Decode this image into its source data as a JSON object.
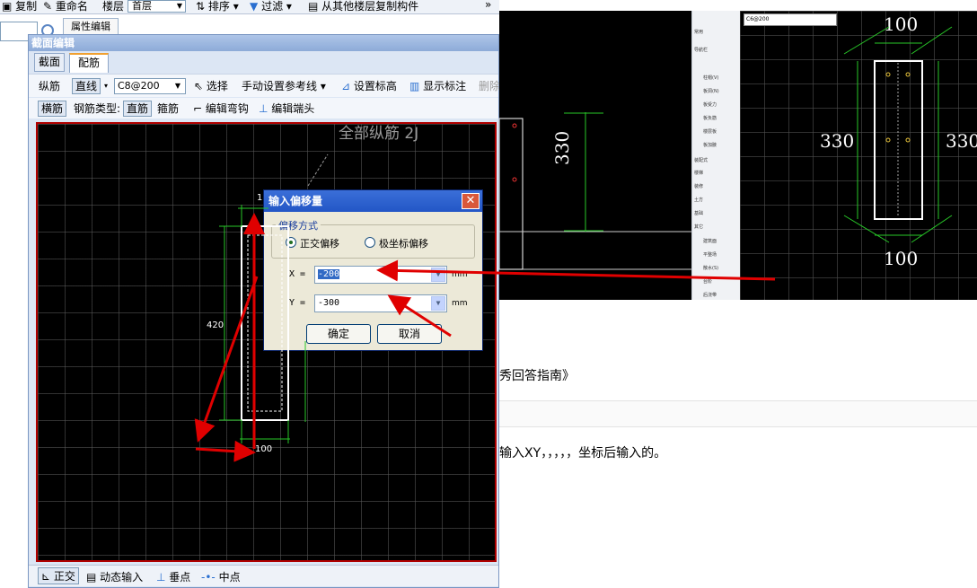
{
  "top_toolbar": {
    "copy": "复制",
    "rename": "重命名",
    "floor_label": "楼层",
    "floor_value": "首层",
    "sort": "排序",
    "filter": "过滤",
    "copy_from_floor": "从其他楼层复制构件",
    "more": "»"
  },
  "prop_tab": "属性编辑",
  "editor": {
    "title": "截面编辑",
    "tabs": [
      "截面",
      "配筋"
    ],
    "row1": {
      "longitudinal": "纵筋",
      "line": "直线",
      "spec_value": "C8@200",
      "select": "选择",
      "manual_ref": "手动设置参考线",
      "set_elevation": "设置标高",
      "show_labels": "显示标注",
      "delete": "删除"
    },
    "row2": {
      "transverse": "横筋",
      "rebar_type_label": "钢筋类型:",
      "straight": "直筋",
      "stirrup": "箍筋",
      "edit_hook": "编辑弯钩",
      "edit_end": "编辑端头"
    },
    "canvas": {
      "annotation": "全部纵筋 2J",
      "dim_top": "10",
      "dim_left": "420",
      "dim_bottom": "100"
    },
    "status": {
      "ortho": "正交",
      "dynamic_input": "动态输入",
      "perpendicular": "垂点",
      "midpoint": "中点"
    }
  },
  "dialog": {
    "title": "输入偏移量",
    "group_label": "偏移方式",
    "opt_ortho": "正交偏移",
    "opt_polar": "极坐标偏移",
    "x_label": "X =",
    "x_value": "-200",
    "y_label": "Y =",
    "y_value": "-300",
    "unit": "mm",
    "ok": "确定",
    "cancel": "取消"
  },
  "right_panel1": {
    "dim": "330"
  },
  "right_panel2": {
    "combo": "C6@200",
    "dim_top": "100",
    "dim_left": "330",
    "dim_right": "330",
    "dim_bottom": "100"
  },
  "sidebar": {
    "items": [
      "常用",
      "导航栏",
      "柱帽(V)",
      "板洞(N)",
      "板受力",
      "板负筋",
      "楼层板",
      "板加腋",
      "装配式",
      "楼梯",
      "装修",
      "土方",
      "基础",
      "其它",
      "建筑面",
      "平整场",
      "散水(S)",
      "台阶",
      "后浇带"
    ]
  },
  "web": {
    "text1": "秀回答指南》",
    "text2": "输入XY，，，，，坐标后输入的。"
  },
  "colors": {
    "arrow": "#e00000",
    "dim_line": "#28c828",
    "canvas_border": "#b00000"
  }
}
